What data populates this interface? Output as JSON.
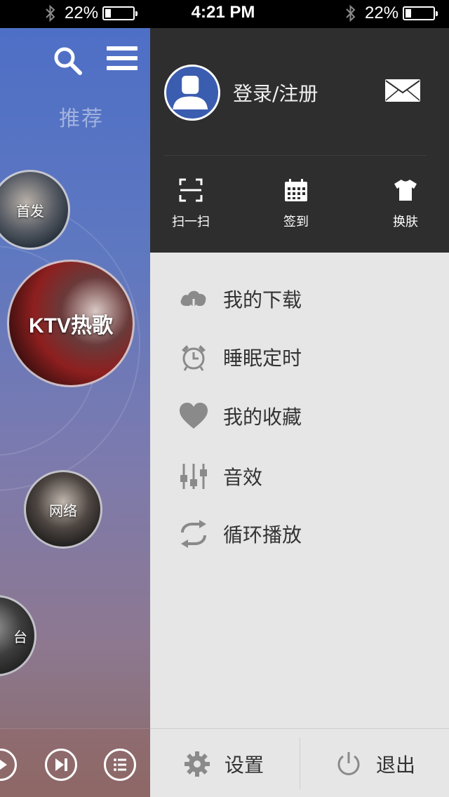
{
  "status_bar": {
    "battery_left": "22%",
    "time": "4:21 PM",
    "battery_right": "22%",
    "battery_level": 0.22
  },
  "background_app": {
    "recommend_title": "推荐",
    "bubbles": {
      "first_release": "首发",
      "ktv_hits": "KTV热歌",
      "network": "网络",
      "radio": "台"
    },
    "icons": [
      "search-icon",
      "menu-icon",
      "play-icon",
      "next-icon",
      "playlist-icon"
    ]
  },
  "drawer": {
    "header": {
      "login_label": "登录/注册",
      "quick_actions": [
        {
          "label": "扫一扫",
          "icon": "scan-icon"
        },
        {
          "label": "签到",
          "icon": "calendar-icon"
        },
        {
          "label": "换肤",
          "icon": "shirt-icon"
        }
      ]
    },
    "menu_items": [
      {
        "label": "我的下载",
        "icon": "cloud-download-icon"
      },
      {
        "label": "睡眠定时",
        "icon": "alarm-clock-icon"
      },
      {
        "label": "我的收藏",
        "icon": "heart-icon"
      },
      {
        "label": "音效",
        "icon": "equalizer-icon"
      },
      {
        "label": "循环播放",
        "icon": "repeat-icon"
      }
    ],
    "footer": {
      "settings_label": "设置",
      "exit_label": "退出"
    }
  },
  "colors": {
    "drawer_header_bg": "#2e2e2e",
    "drawer_body_bg": "#e6e6e6",
    "avatar_blue": "#3b5db0",
    "icon_gray": "#8a8a8a"
  }
}
